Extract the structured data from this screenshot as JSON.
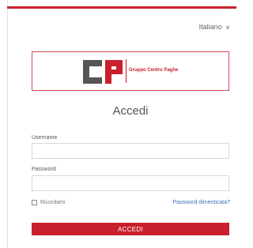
{
  "header": {
    "language": "Italiano",
    "language_chevron": "∨"
  },
  "logo": {
    "brand_text": "Gruppo Centro Paghe"
  },
  "login": {
    "title": "Accedi",
    "username_label": "Username",
    "username_value": "",
    "password_label": "Password",
    "password_value": "",
    "remember_label": "Ricordami",
    "forgot_link": "Password dimenticata?",
    "submit_label": "ACCEDI"
  },
  "colors": {
    "accent": "#c8202c",
    "logo_grey": "#555555",
    "link": "#3d6fb5"
  }
}
